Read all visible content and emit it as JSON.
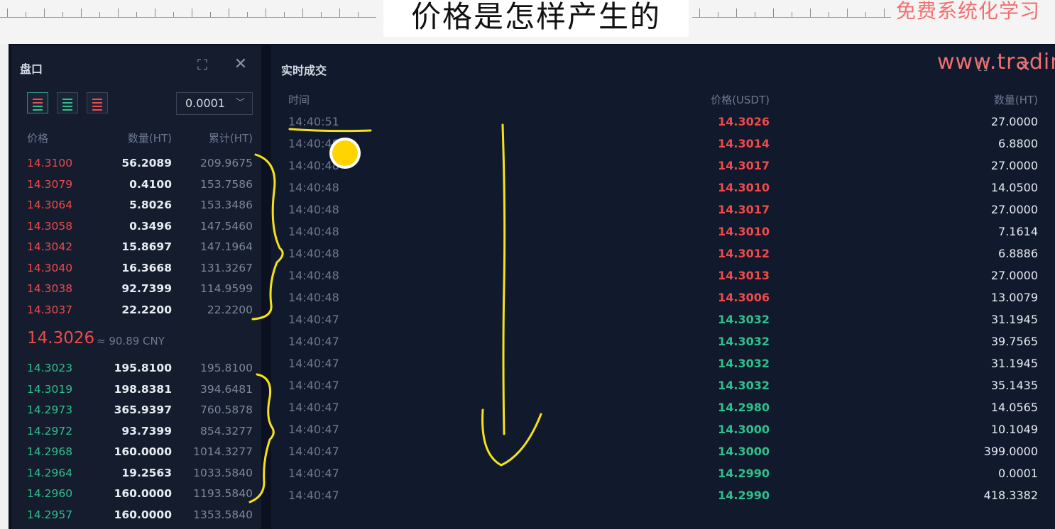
{
  "video": {
    "title": "价格是怎样产生的",
    "watermark": "免费系统化学习",
    "site_watermark": "www.tradin"
  },
  "order_book": {
    "title": "盘口",
    "precision": "0.0001",
    "headers": {
      "price": "价格",
      "amount": "数量(HT)",
      "total": "累计(HT)"
    },
    "asks": [
      {
        "price": "14.3100",
        "amount": "56.2089",
        "total": "209.9675"
      },
      {
        "price": "14.3079",
        "amount": "0.4100",
        "total": "153.7586"
      },
      {
        "price": "14.3064",
        "amount": "5.8026",
        "total": "153.3486"
      },
      {
        "price": "14.3058",
        "amount": "0.3496",
        "total": "147.5460"
      },
      {
        "price": "14.3042",
        "amount": "15.8697",
        "total": "147.1964"
      },
      {
        "price": "14.3040",
        "amount": "16.3668",
        "total": "131.3267"
      },
      {
        "price": "14.3038",
        "amount": "92.7399",
        "total": "114.9599"
      },
      {
        "price": "14.3037",
        "amount": "22.2200",
        "total": "22.2200"
      }
    ],
    "last_price": "14.3026",
    "last_price_cny": "≈ 90.89 CNY",
    "bids": [
      {
        "price": "14.3023",
        "amount": "195.8100",
        "total": "195.8100"
      },
      {
        "price": "14.3019",
        "amount": "198.8381",
        "total": "394.6481"
      },
      {
        "price": "14.2973",
        "amount": "365.9397",
        "total": "760.5878"
      },
      {
        "price": "14.2972",
        "amount": "93.7399",
        "total": "854.3277"
      },
      {
        "price": "14.2968",
        "amount": "160.0000",
        "total": "1014.3277"
      },
      {
        "price": "14.2964",
        "amount": "19.2563",
        "total": "1033.5840"
      },
      {
        "price": "14.2960",
        "amount": "160.0000",
        "total": "1193.5840"
      },
      {
        "price": "14.2957",
        "amount": "160.0000",
        "total": "1353.5840"
      }
    ]
  },
  "trades": {
    "title": "实时成交",
    "headers": {
      "time": "时间",
      "price": "价格(USDT)",
      "amount": "数量(HT)"
    },
    "rows": [
      {
        "time": "14:40:51",
        "price": "14.3026",
        "amount": "27.0000",
        "side": "sell"
      },
      {
        "time": "14:40:48",
        "price": "14.3014",
        "amount": "6.8800",
        "side": "sell"
      },
      {
        "time": "14:40:48",
        "price": "14.3017",
        "amount": "27.0000",
        "side": "sell"
      },
      {
        "time": "14:40:48",
        "price": "14.3010",
        "amount": "14.0500",
        "side": "sell"
      },
      {
        "time": "14:40:48",
        "price": "14.3017",
        "amount": "27.0000",
        "side": "sell"
      },
      {
        "time": "14:40:48",
        "price": "14.3010",
        "amount": "7.1614",
        "side": "sell"
      },
      {
        "time": "14:40:48",
        "price": "14.3012",
        "amount": "6.8886",
        "side": "sell"
      },
      {
        "time": "14:40:48",
        "price": "14.3013",
        "amount": "27.0000",
        "side": "sell"
      },
      {
        "time": "14:40:48",
        "price": "14.3006",
        "amount": "13.0079",
        "side": "sell"
      },
      {
        "time": "14:40:47",
        "price": "14.3032",
        "amount": "31.1945",
        "side": "buy"
      },
      {
        "time": "14:40:47",
        "price": "14.3032",
        "amount": "39.7565",
        "side": "buy"
      },
      {
        "time": "14:40:47",
        "price": "14.3032",
        "amount": "31.1945",
        "side": "buy"
      },
      {
        "time": "14:40:47",
        "price": "14.3032",
        "amount": "35.1435",
        "side": "buy"
      },
      {
        "time": "14:40:47",
        "price": "14.2980",
        "amount": "14.0565",
        "side": "buy"
      },
      {
        "time": "14:40:47",
        "price": "14.3000",
        "amount": "10.1049",
        "side": "buy"
      },
      {
        "time": "14:40:47",
        "price": "14.3000",
        "amount": "399.0000",
        "side": "buy"
      },
      {
        "time": "14:40:47",
        "price": "14.2990",
        "amount": "0.0001",
        "side": "buy"
      },
      {
        "time": "14:40:47",
        "price": "14.2990",
        "amount": "418.3382",
        "side": "buy"
      }
    ]
  },
  "colors": {
    "sell": "#f04a4a",
    "buy": "#2fbf8a",
    "annotation": "#f5e21b",
    "cursor": "#ffd400"
  },
  "icons": {
    "expand": "expand-icon",
    "close": "close-icon",
    "dropdown": "chevron-down-icon"
  }
}
